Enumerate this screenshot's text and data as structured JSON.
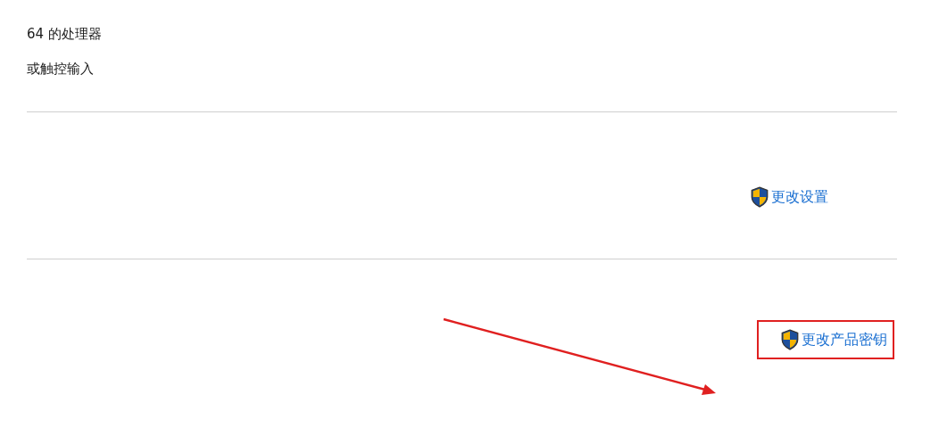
{
  "system_lines": [
    "64 的处理器",
    "或触控输入"
  ],
  "settings_link": {
    "label": "更改设置"
  },
  "product_key_link": {
    "label": "更改产品密钥",
    "highlighted": true
  }
}
